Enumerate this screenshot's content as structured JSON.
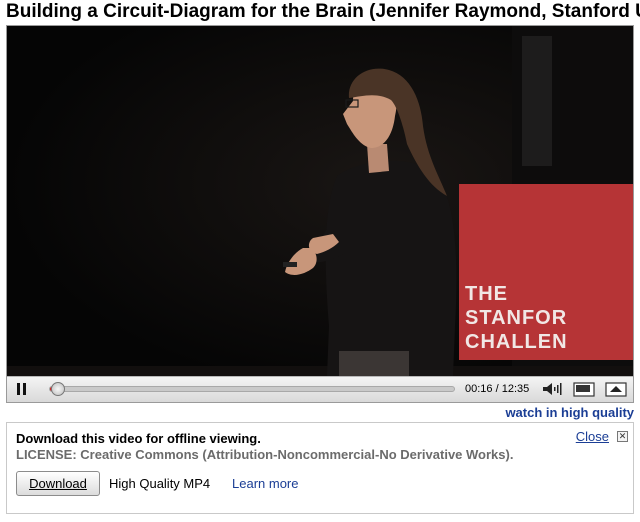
{
  "video": {
    "title": "Building a Circuit-Diagram for the Brain (Jennifer Raymond, Stanford U",
    "banner_lines": [
      "THE",
      "STANFOR",
      "CHALLEN"
    ]
  },
  "controls": {
    "play_state_icon": "pause-icon",
    "current_time": "00:16",
    "separator": "/",
    "duration": "12:35",
    "progress_fraction": 0.021,
    "buttons": [
      "volume-icon",
      "popout-icon",
      "expand-icon"
    ]
  },
  "watch_hq_link": "watch in high quality",
  "download": {
    "heading": "Download this video for offline viewing.",
    "license": "LICENSE: Creative Commons (Attribution-Noncommercial-No Derivative Works).",
    "close_label": "Close",
    "close_icon": "close-icon",
    "button_label": "Download",
    "format": "High Quality MP4",
    "learn_more": "Learn more"
  },
  "colors": {
    "link": "#1b3e95",
    "progress": "#d81e1e",
    "banner": "#b63436"
  }
}
